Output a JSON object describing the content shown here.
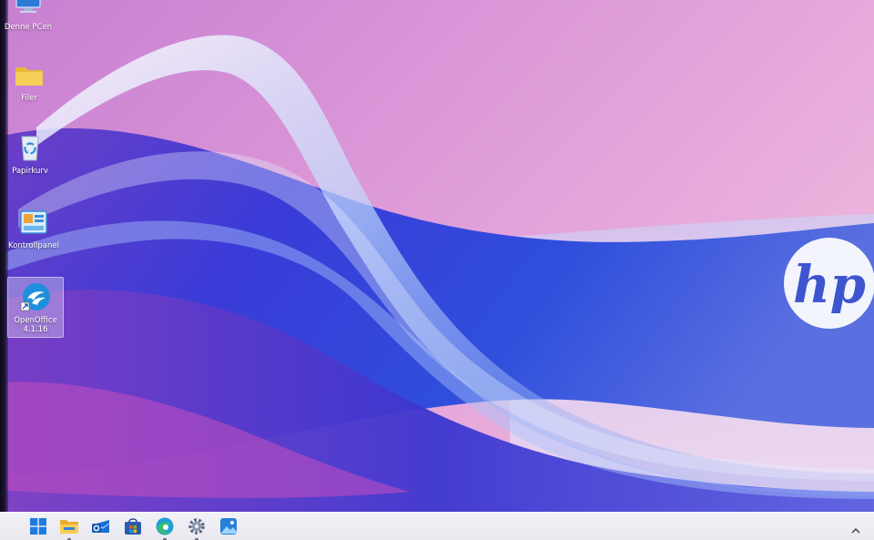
{
  "desktop": {
    "icons": [
      {
        "label": "Denne PCen",
        "icon": "this-pc-icon"
      },
      {
        "label": "Filer",
        "icon": "folder-icon"
      },
      {
        "label": "Papirkurv",
        "icon": "recycle-bin-icon"
      },
      {
        "label": "Kontrollpanel",
        "icon": "control-panel-icon"
      },
      {
        "label": "OpenOffice\n4.1.16",
        "icon": "openoffice-icon",
        "selected": true
      }
    ],
    "wallpaper": {
      "logo_text": "hp",
      "colors": {
        "pink": "#e6a6dc",
        "violet": "#8e4fc9",
        "blue": "#2f43d6",
        "light_blue": "#9ec4f5"
      }
    }
  },
  "taskbar": {
    "items": [
      {
        "icon": "windows-start-icon"
      },
      {
        "icon": "file-explorer-icon"
      },
      {
        "icon": "outlook-icon"
      },
      {
        "icon": "microsoft-store-icon"
      },
      {
        "icon": "edge-browser-icon"
      },
      {
        "icon": "settings-gear-icon"
      },
      {
        "icon": "photos-icon"
      }
    ],
    "tray": {
      "icon": "chevron-up-icon"
    }
  }
}
